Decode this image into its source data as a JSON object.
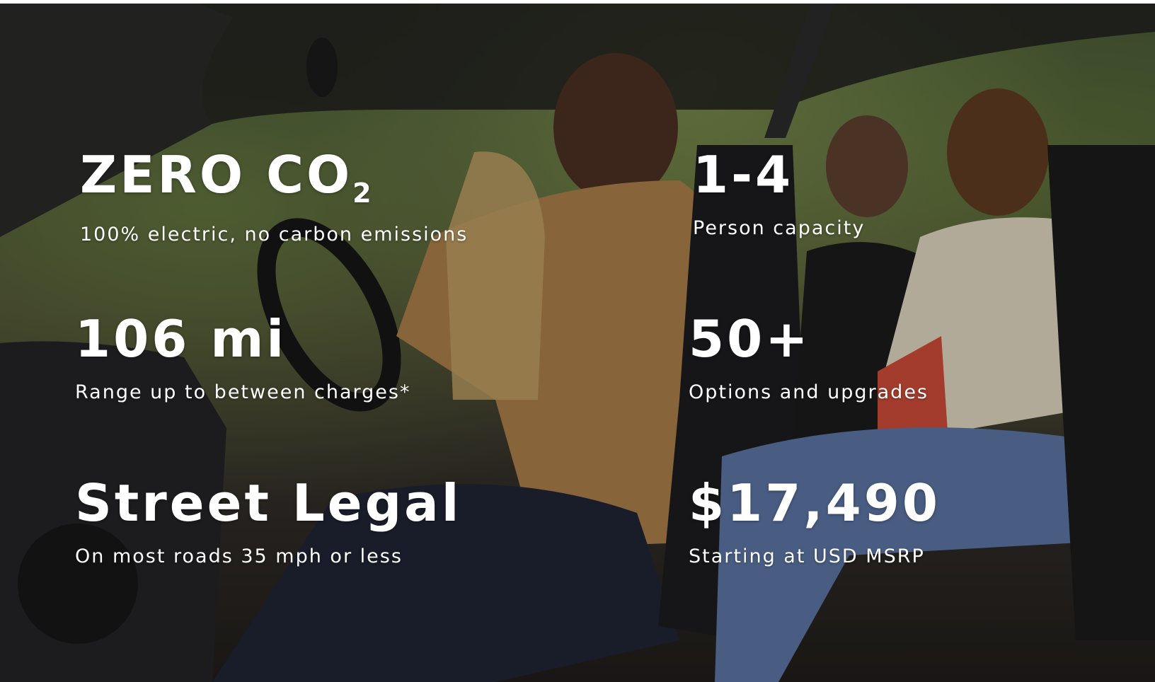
{
  "stats": [
    {
      "headline": "ZERO CO",
      "subscript": "2",
      "caption": "100% electric, no carbon emissions"
    },
    {
      "headline": "1-4",
      "caption": "Person capacity"
    },
    {
      "headline": "106 mi",
      "caption": "Range up to between charges*"
    },
    {
      "headline": "50+",
      "caption": "Options and upgrades"
    },
    {
      "headline": "Street Legal",
      "caption": "On most roads 35 mph or less"
    },
    {
      "headline": "$17,490",
      "caption": "Starting at USD MSRP"
    }
  ],
  "colors": {
    "text": "#ffffff",
    "overlay": "#000000"
  }
}
